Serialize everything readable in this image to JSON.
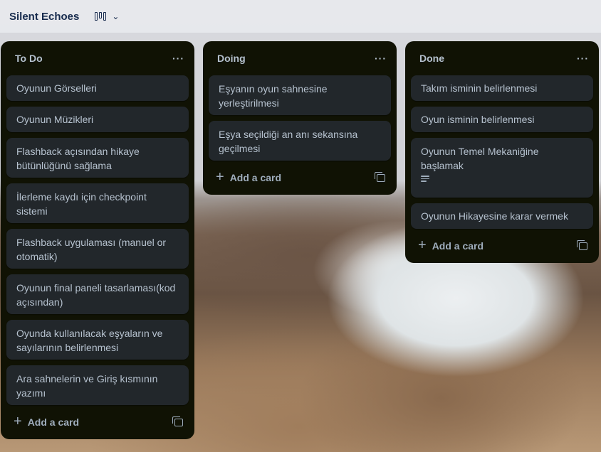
{
  "board": {
    "title": "Silent Echoes"
  },
  "lists": [
    {
      "title": "To Do",
      "menu_label": "···",
      "cards": [
        "Oyunun Görselleri",
        "Oyunun Müzikleri",
        "Flashback açısından hikaye bütünlüğünü sağlama",
        "İlerleme kaydı için checkpoint sistemi",
        "Flashback uygulaması (manuel or otomatik)",
        "Oyunun final paneli tasarlaması(kod açısından)",
        "Oyunda kullanılacak eşyaların ve sayılarının belirlenmesi",
        "Ara sahnelerin ve Giriş kısmının yazımı"
      ],
      "add_label": "Add a card"
    },
    {
      "title": "Doing",
      "menu_label": "···",
      "cards": [
        "Eşyanın oyun sahnesine yerleştirilmesi",
        "Eşya seçildiği an anı sekansına geçilmesi"
      ],
      "add_label": "Add a card"
    },
    {
      "title": "Done",
      "menu_label": "···",
      "cards": [
        "Takım isminin belirlenmesi",
        "Oyun isminin belirlenmesi",
        "Oyunun Temel Mekaniğine başlamak",
        "Oyunun Hikayesine karar vermek"
      ],
      "add_label": "Add a card"
    }
  ],
  "icons": {
    "view_switch": "board-view-icon",
    "chevron": "chevron-down-icon",
    "menu": "more-horizontal-icon",
    "add": "plus-icon",
    "template": "card-template-icon",
    "description": "description-icon"
  },
  "colors": {
    "list_bg": "#101204",
    "card_bg": "#22272b",
    "text": "#b6c2cf",
    "title_dark": "#172b4d"
  }
}
